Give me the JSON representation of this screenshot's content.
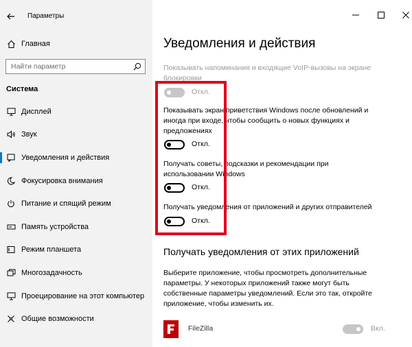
{
  "window": {
    "title": "Параметры"
  },
  "sidebar": {
    "home_label": "Главная",
    "search_placeholder": "Найти параметр",
    "group_title": "Система",
    "items": [
      {
        "label": "Дисплей",
        "icon": "monitor-icon"
      },
      {
        "label": "Звук",
        "icon": "speaker-icon"
      },
      {
        "label": "Уведомления и действия",
        "icon": "notification-icon"
      },
      {
        "label": "Фокусировка внимания",
        "icon": "moon-icon"
      },
      {
        "label": "Питание и спящий режим",
        "icon": "power-icon"
      },
      {
        "label": "Память устройства",
        "icon": "storage-icon"
      },
      {
        "label": "Режим планшета",
        "icon": "tablet-icon"
      },
      {
        "label": "Многозадачность",
        "icon": "multitask-icon"
      },
      {
        "label": "Проецирование на этот компьютер",
        "icon": "project-icon"
      },
      {
        "label": "Общие возможности",
        "icon": "shared-icon"
      }
    ],
    "active_index": 2
  },
  "main": {
    "title": "Уведомления и действия",
    "options": [
      {
        "text": "Показывать напоминания и входящие VoIP-вызовы на экране блокировки",
        "state": "Откл.",
        "disabled": true
      },
      {
        "text": "Показывать экран приветствия Windows после обновлений и иногда при входе, чтобы сообщить о новых функциях и предложениях",
        "state": "Откл.",
        "disabled": false
      },
      {
        "text": "Получать советы, подсказки и рекомендации при использовании Windows",
        "state": "Откл.",
        "disabled": false
      },
      {
        "text": "Получать уведомления от приложений и других отправителей",
        "state": "Откл.",
        "disabled": false
      }
    ],
    "apps_section": {
      "title": "Получать уведомления от этих приложений",
      "description": "Выберите приложение, чтобы просмотреть дополнительные параметры. У некоторых приложений также могут быть собственные параметры уведомлений. Если это так, откройте приложение, чтобы изменить их.",
      "apps": [
        {
          "name": "FileZilla",
          "icon": "filezilla-icon",
          "icon_letter": "F",
          "state": "Вкл."
        }
      ]
    }
  },
  "colors": {
    "accent": "#0078d7",
    "highlight": "#e0001b",
    "sidebar_bg": "#f2f2f2",
    "filezilla": "#bf0000"
  }
}
